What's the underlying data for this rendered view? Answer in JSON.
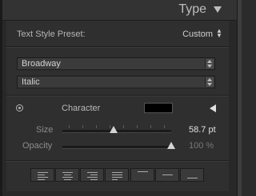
{
  "header": {
    "title": "Type"
  },
  "preset": {
    "label": "Text Style Preset:",
    "value": "Custom",
    "arrows": "⌃⌄"
  },
  "font": {
    "family": "Broadway",
    "style": "Italic"
  },
  "character": {
    "label": "Character",
    "color": "#000000"
  },
  "size": {
    "label": "Size",
    "value": "58.7",
    "unit": "pt",
    "fraction": 0.47
  },
  "opacity": {
    "label": "Opacity",
    "value": "100",
    "unit": "%",
    "fraction": 1.0
  },
  "alignment": {
    "buttons": [
      "align-left",
      "align-center",
      "align-right",
      "justify",
      "align-top",
      "align-middle",
      "align-bottom"
    ]
  }
}
